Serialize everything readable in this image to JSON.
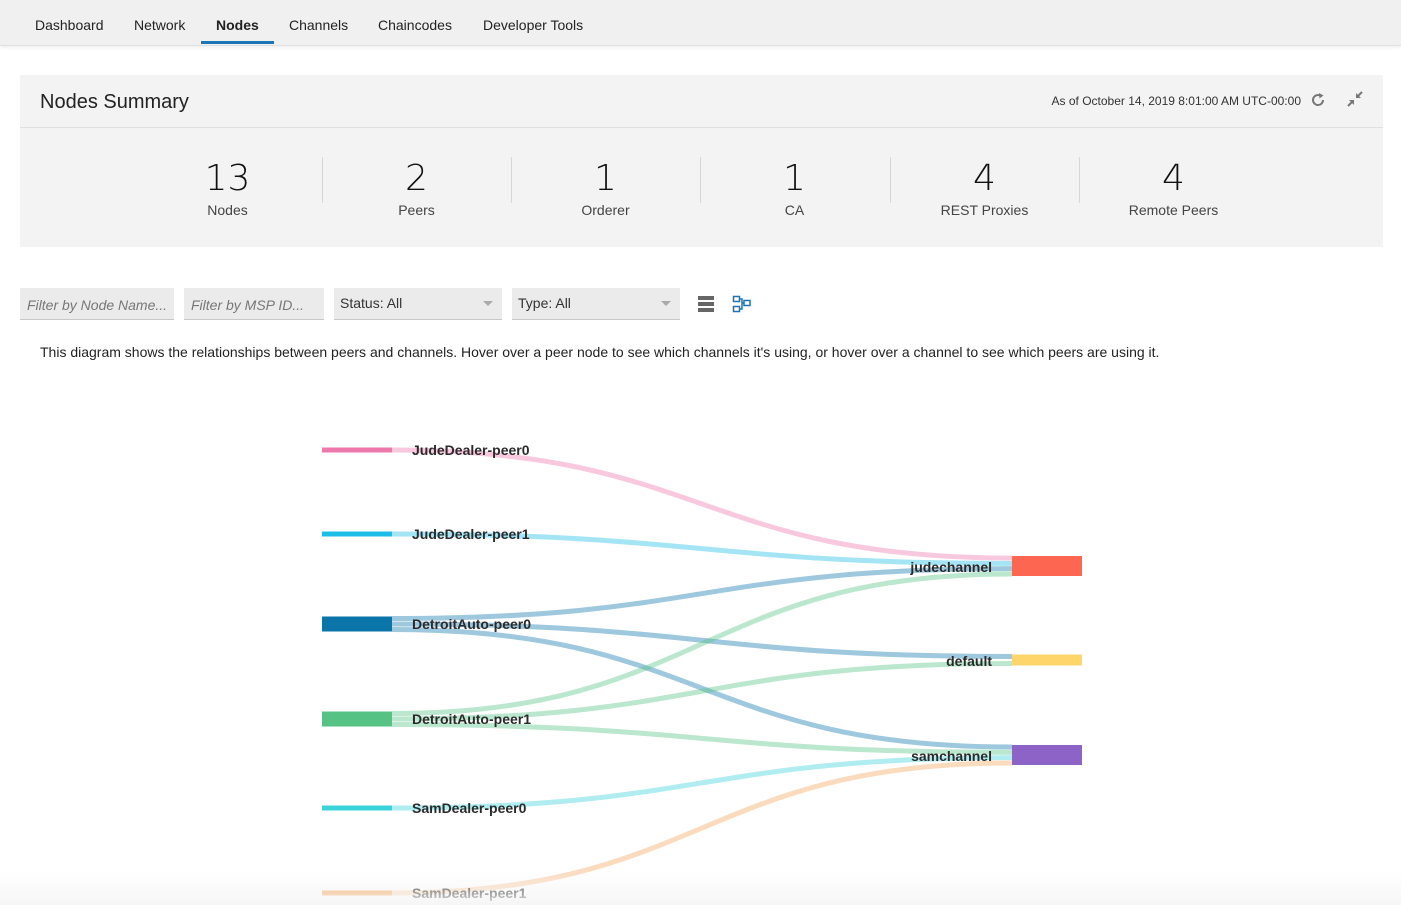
{
  "nav": {
    "tabs": [
      {
        "label": "Dashboard"
      },
      {
        "label": "Network"
      },
      {
        "label": "Nodes",
        "active": true
      },
      {
        "label": "Channels"
      },
      {
        "label": "Chaincodes"
      },
      {
        "label": "Developer Tools"
      }
    ]
  },
  "summary": {
    "title": "Nodes Summary",
    "as_of": "As of October 14, 2019 8:01:00 AM UTC-00:00",
    "stats": [
      {
        "value": "13",
        "label": "Nodes"
      },
      {
        "value": "2",
        "label": "Peers"
      },
      {
        "value": "1",
        "label": "Orderer"
      },
      {
        "value": "1",
        "label": "CA"
      },
      {
        "value": "4",
        "label": "REST Proxies"
      },
      {
        "value": "4",
        "label": "Remote Peers"
      }
    ]
  },
  "filters": {
    "node_name_placeholder": "Filter by Node Name...",
    "msp_id_placeholder": "Filter by MSP ID...",
    "status": "Status: All",
    "type": "Type: All"
  },
  "description": "This diagram shows the relationships between peers and channels. Hover over a peer node to see which channels it's using, or hover over a channel to see which peers are using it.",
  "diagram": {
    "peers": [
      {
        "name": "JudeDealer-peer0",
        "color": "#ee77ac"
      },
      {
        "name": "JudeDealer-peer1",
        "color": "#1cbde6"
      },
      {
        "name": "DetroitAuto-peer0",
        "color": "#0b75aa"
      },
      {
        "name": "DetroitAuto-peer1",
        "color": "#56c384"
      },
      {
        "name": "SamDealer-peer0",
        "color": "#39d3dd"
      },
      {
        "name": "SamDealer-peer1",
        "color": "#f6a55a"
      }
    ],
    "channels": [
      {
        "name": "judechannel",
        "color": "#fd6650"
      },
      {
        "name": "default",
        "color": "#fed56a"
      },
      {
        "name": "samchannel",
        "color": "#8d63c8"
      }
    ],
    "links": [
      {
        "peer": "JudeDealer-peer0",
        "channel": "judechannel"
      },
      {
        "peer": "JudeDealer-peer1",
        "channel": "judechannel"
      },
      {
        "peer": "DetroitAuto-peer0",
        "channel": "judechannel"
      },
      {
        "peer": "DetroitAuto-peer0",
        "channel": "default"
      },
      {
        "peer": "DetroitAuto-peer0",
        "channel": "samchannel"
      },
      {
        "peer": "DetroitAuto-peer1",
        "channel": "judechannel"
      },
      {
        "peer": "DetroitAuto-peer1",
        "channel": "default"
      },
      {
        "peer": "DetroitAuto-peer1",
        "channel": "samchannel"
      },
      {
        "peer": "SamDealer-peer0",
        "channel": "samchannel"
      },
      {
        "peer": "SamDealer-peer1",
        "channel": "samchannel"
      }
    ]
  }
}
